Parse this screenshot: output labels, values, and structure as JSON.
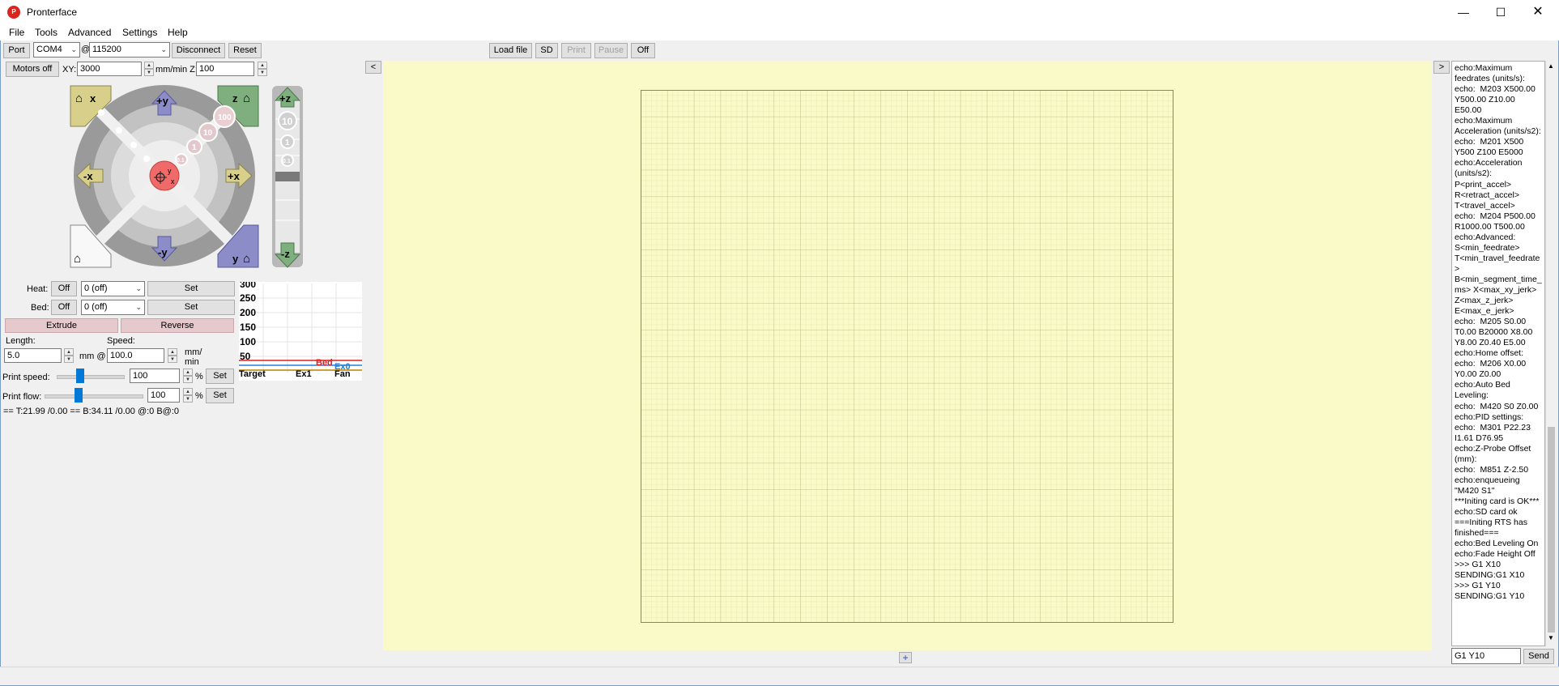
{
  "window": {
    "title": "Pronterface",
    "icon": "pronterface-logo-icon"
  },
  "menu": [
    "File",
    "Tools",
    "Advanced",
    "Settings",
    "Help"
  ],
  "toolbar": {
    "port_label": "Port",
    "port_value": "COM4",
    "at": "@",
    "baud_value": "115200",
    "disconnect": "Disconnect",
    "reset": "Reset",
    "load_file": "Load file",
    "sd": "SD",
    "print": "Print",
    "pause": "Pause",
    "off": "Off"
  },
  "motors": {
    "motors_off": "Motors off",
    "xy_label": "XY:",
    "xy_value": "3000",
    "unit_z": "mm/min Z:",
    "z_value": "100"
  },
  "jog": {
    "plus_y": "+y",
    "minus_y": "-y",
    "plus_x": "+x",
    "minus_x": "-x",
    "home_x": "x",
    "home_z": "z",
    "home_y": "y",
    "plus_z": "+z",
    "minus_z": "-z",
    "steps": [
      "100",
      "10",
      "1",
      "0.1"
    ],
    "z_steps": [
      "10",
      "1",
      "0.1"
    ],
    "center": "y x"
  },
  "temps": {
    "heat_label": "Heat:",
    "bed_label": "Bed:",
    "off": "Off",
    "heat_value": "0 (off)",
    "bed_value": "0 (off)",
    "set": "Set"
  },
  "extrude": {
    "extrude": "Extrude",
    "reverse": "Reverse",
    "length_label": "Length:",
    "speed_label": "Speed:",
    "length_value": "5.0",
    "mm_at": "mm @",
    "speed_value": "100.0",
    "speed_unit_1": "mm/",
    "speed_unit_2": "min"
  },
  "speeds": {
    "print_speed_label": "Print speed:",
    "print_speed_value": "100",
    "print_speed_fraction": 0.35,
    "print_flow_label": "Print flow:",
    "print_flow_value": "100",
    "print_flow_fraction": 0.35,
    "percent": "%",
    "set": "Set"
  },
  "status_line": "== T:21.99 /0.00 == B:34.11 /0.00 @:0 B@:0",
  "graph": {
    "y_ticks": [
      "300",
      "250",
      "200",
      "150",
      "100",
      "50"
    ],
    "x_labels": [
      "Target",
      "Ex1",
      "Fan"
    ],
    "bed_label": "Bed",
    "ex0_label": "Ex0",
    "colors": {
      "bed": "#e02020",
      "ex0": "#2080e0",
      "target": "#c08000"
    }
  },
  "panel": {
    "collapse_left": "<",
    "collapse_right": ">",
    "expand_bottom": "+"
  },
  "console": {
    "lines": "echo:Maximum feedrates (units/s):\necho:  M203 X500.00 Y500.00 Z10.00 E50.00\necho:Maximum Acceleration (units/s2):\necho:  M201 X500 Y500 Z100 E5000\necho:Acceleration (units/s2): P<print_accel> R<retract_accel> T<travel_accel>\necho:  M204 P500.00 R1000.00 T500.00\necho:Advanced: S<min_feedrate> T<min_travel_feedrate> B<min_segment_time_ms> X<max_xy_jerk> Z<max_z_jerk> E<max_e_jerk>\necho:  M205 S0.00 T0.00 B20000 X8.00 Y8.00 Z0.40 E5.00\necho:Home offset:\necho:  M206 X0.00 Y0.00 Z0.00\necho:Auto Bed Leveling:\necho:  M420 S0 Z0.00\necho:PID settings:\necho:  M301 P22.23 I1.61 D76.95\necho:Z-Probe Offset (mm):\necho:  M851 Z-2.50\necho:enqueueing \"M420 S1\"\n***Initing card is OK***\necho:SD card ok\n===Initing RTS has finished===\necho:Bed Leveling On\necho:Fade Height Off\n>>> G1 X10\nSENDING:G1 X10\n>>> G1 Y10\nSENDING:G1 Y10",
    "input_value": "G1 Y10",
    "send": "Send"
  }
}
